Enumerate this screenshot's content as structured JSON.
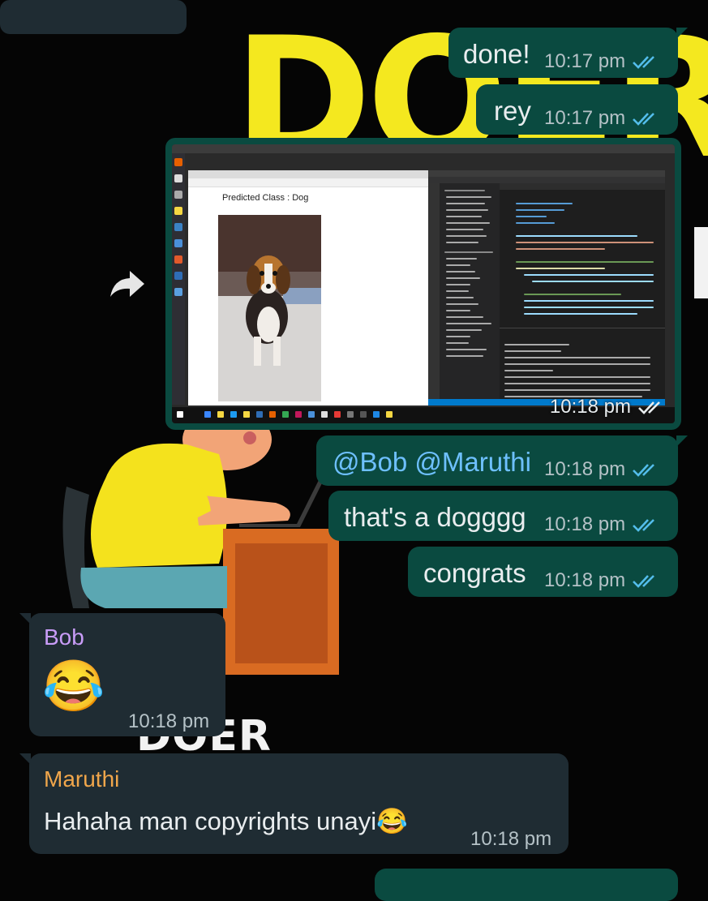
{
  "wallpaper": {
    "headline": "DOERS",
    "side_letter": "E",
    "bottom_text": "DOER"
  },
  "messages": [
    {
      "text": "done!",
      "time": "10:17 pm",
      "status": "read-double-check-icon"
    },
    {
      "text": "rey",
      "time": "10:17 pm",
      "status": "read-double-check-icon"
    },
    {
      "type": "image",
      "time": "10:18 pm",
      "status": "read-double-check-icon",
      "screenshot": {
        "predicted_label": "Predicted Class : Dog"
      }
    },
    {
      "mentions": "@Bob @Maruthi",
      "time": "10:18 pm",
      "status": "read-double-check-icon"
    },
    {
      "text": "that's a dogggg",
      "time": "10:18 pm",
      "status": "read-double-check-icon"
    },
    {
      "text": "congrats",
      "time": "10:18 pm",
      "status": "read-double-check-icon"
    },
    {
      "sender": "Bob",
      "sender_color": "#c89cf7",
      "emoji": "😂",
      "time": "10:18 pm"
    },
    {
      "sender": "Maruthi",
      "sender_color": "#f0a64b",
      "text": "Hahaha man copyrights unayi😂",
      "time": "10:18 pm"
    }
  ],
  "colors": {
    "outgoing_bubble": "#0a4a40",
    "incoming_bubble": "#1f2c33",
    "read_ticks": "#53bdeb",
    "mention": "#6ec0ff"
  },
  "icons": {
    "forward": "forward-arrow-icon"
  }
}
